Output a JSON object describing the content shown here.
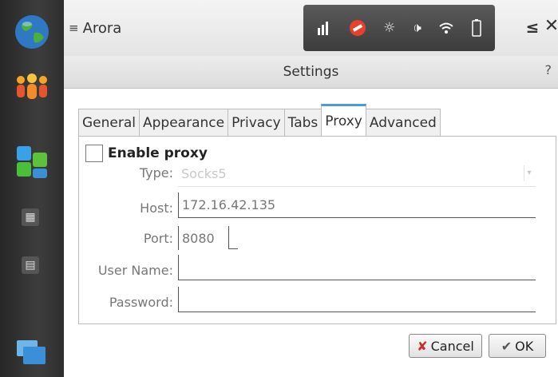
{
  "window": {
    "app_title": "Arora",
    "icons": {
      "menu": "menu-lines-icon",
      "minimize": "minimize-icon",
      "close": "close-icon"
    },
    "minimize_glyph": "≤",
    "close_glyph": "✕"
  },
  "status_icons": [
    "signal-icon",
    "presence-icon",
    "brightness-icon",
    "volume-icon",
    "wifi-icon",
    "battery-icon"
  ],
  "launcher": [
    "browser-globe-icon",
    "contacts-icon",
    "app-cubes-icon",
    "apps-grid-icon",
    "task-switcher-icon",
    "windows-icon"
  ],
  "dialog": {
    "title": "Settings",
    "help": "?",
    "tabs": [
      "General",
      "Appearance",
      "Privacy",
      "Tabs",
      "Proxy",
      "Advanced"
    ],
    "active_tab": "Proxy",
    "enable_proxy": {
      "label": "Enable proxy",
      "checked": false
    },
    "type": {
      "label": "Type:",
      "value": "Socks5"
    },
    "host": {
      "label": "Host:",
      "value": "172.16.42.135"
    },
    "port": {
      "label": "Port:",
      "value": "8080"
    },
    "user_name": {
      "label": "User Name:",
      "value": ""
    },
    "password": {
      "label": "Password:",
      "value": ""
    },
    "cancel_label": "Cancel",
    "ok_label": "OK"
  },
  "colors": {
    "active_tab_accent": "#4a9bd6",
    "launcher_bg": "#333333",
    "status_bg": "#4a4a4a",
    "cancel_icon": "#cc2b2b"
  }
}
